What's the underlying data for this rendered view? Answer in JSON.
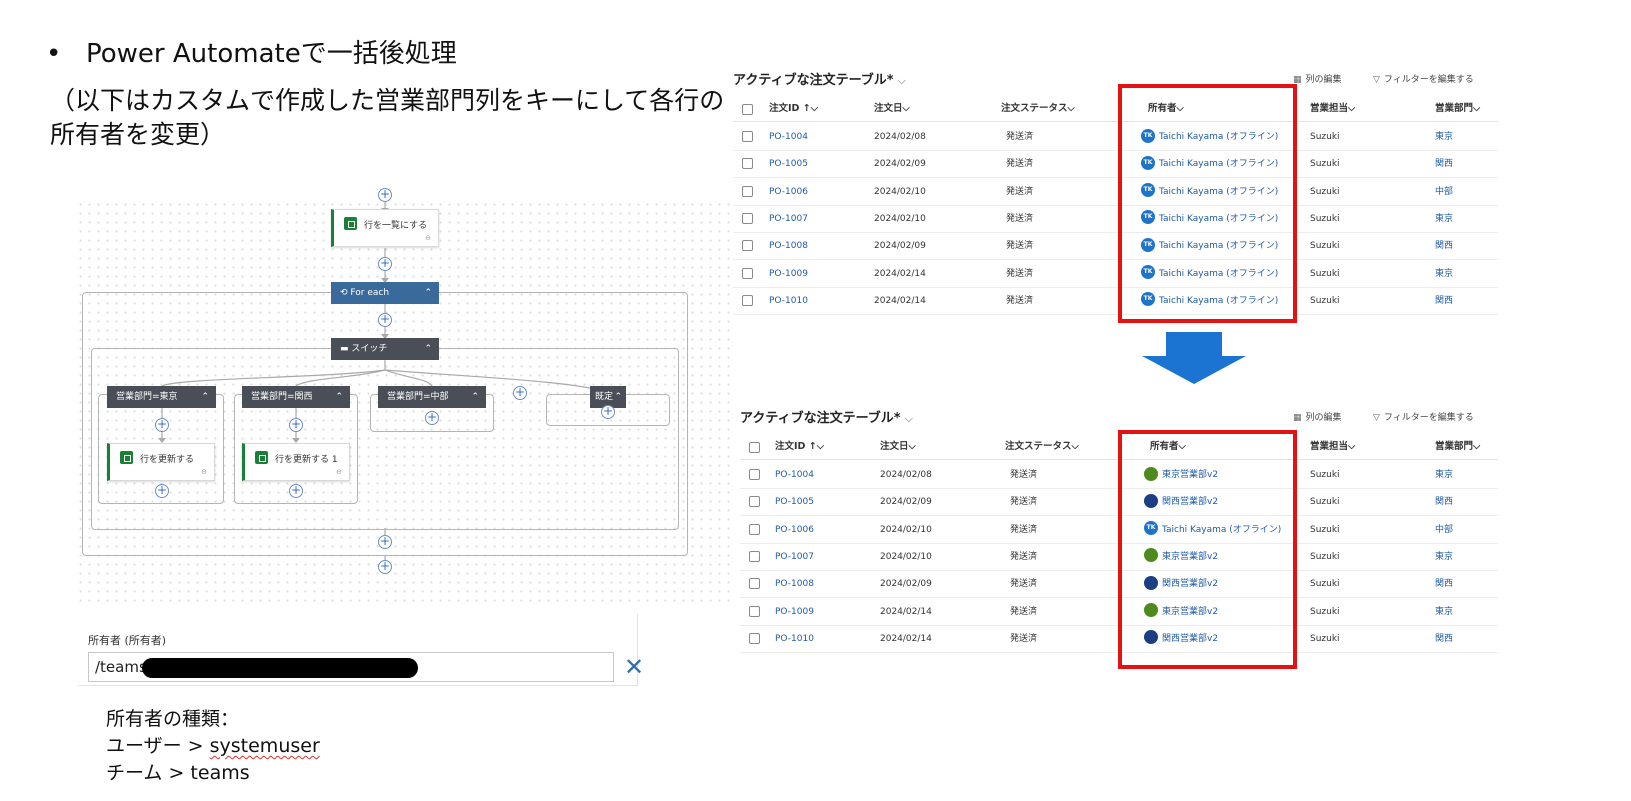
{
  "slide": {
    "bullet": "Power Automateで一括後処理",
    "subtitle": "（以下はカスタムで作成した営業部門列をキーにして各行の所有者を変更）"
  },
  "flow": {
    "list_rows_label": "行を一覧にする",
    "for_each_label": "For each",
    "switch_label": "スイッチ",
    "case_tokyo_label": "営業部門=東京",
    "case_kansai_label": "営業部門=関西",
    "case_chubu_label": "営業部門=中部",
    "default_label": "既定",
    "update_row_label": "行を更新する",
    "update_row_1_label": "行を更新する 1",
    "colors": {
      "action": "#1a7f37",
      "foreach": "#3a6a9c",
      "control": "#4a4f57",
      "plus": "#3a6cc2"
    },
    "icons": [
      "add-step-icon",
      "dataverse-icon",
      "link-icon",
      "loop-icon",
      "switch-icon",
      "chevron-up-icon"
    ]
  },
  "owner_field": {
    "label": "所有者 (所有者)",
    "value": "/teams/",
    "clear_icon": "close-icon"
  },
  "notes": {
    "title": "所有者の種類：",
    "user_line_prefix": "ユーザー > ",
    "user_line_value": "systemuser",
    "team_line": "チーム > teams"
  },
  "table": {
    "title": "アクティブな注文テーブル*",
    "title_chevron": "⌵",
    "edit_columns": "列の編集",
    "edit_filters": "フィルターを編集する",
    "columns": {
      "order_id": "注文ID ↑⌵",
      "order_date": "注文日⌵",
      "status": "注文ステータス⌵",
      "owner": "所有者⌵",
      "sales_rep": "営業担当⌵",
      "department": "営業部門⌵"
    },
    "highlight_color": "#e41212",
    "arrow_color": "#1b74d1"
  },
  "before_rows": [
    {
      "id": "PO-1004",
      "date": "2024/02/08",
      "status": "発送済",
      "owner": "Taichi Kayama (オフライン)",
      "owner_initials": "TK",
      "owner_type": "tk",
      "rep": "Suzuki",
      "dept": "東京"
    },
    {
      "id": "PO-1005",
      "date": "2024/02/09",
      "status": "発送済",
      "owner": "Taichi Kayama (オフライン)",
      "owner_initials": "TK",
      "owner_type": "tk",
      "rep": "Suzuki",
      "dept": "関西"
    },
    {
      "id": "PO-1006",
      "date": "2024/02/10",
      "status": "発送済",
      "owner": "Taichi Kayama (オフライン)",
      "owner_initials": "TK",
      "owner_type": "tk",
      "rep": "Suzuki",
      "dept": "中部"
    },
    {
      "id": "PO-1007",
      "date": "2024/02/10",
      "status": "発送済",
      "owner": "Taichi Kayama (オフライン)",
      "owner_initials": "TK",
      "owner_type": "tk",
      "rep": "Suzuki",
      "dept": "東京"
    },
    {
      "id": "PO-1008",
      "date": "2024/02/09",
      "status": "発送済",
      "owner": "Taichi Kayama (オフライン)",
      "owner_initials": "TK",
      "owner_type": "tk",
      "rep": "Suzuki",
      "dept": "関西"
    },
    {
      "id": "PO-1009",
      "date": "2024/02/14",
      "status": "発送済",
      "owner": "Taichi Kayama (オフライン)",
      "owner_initials": "TK",
      "owner_type": "tk",
      "rep": "Suzuki",
      "dept": "東京"
    },
    {
      "id": "PO-1010",
      "date": "2024/02/14",
      "status": "発送済",
      "owner": "Taichi Kayama (オフライン)",
      "owner_initials": "TK",
      "owner_type": "tk",
      "rep": "Suzuki",
      "dept": "関西"
    }
  ],
  "after_rows": [
    {
      "id": "PO-1004",
      "date": "2024/02/08",
      "status": "発送済",
      "owner": "東京営業部v2",
      "owner_initials": "",
      "owner_type": "green",
      "rep": "Suzuki",
      "dept": "東京"
    },
    {
      "id": "PO-1005",
      "date": "2024/02/09",
      "status": "発送済",
      "owner": "関西営業部v2",
      "owner_initials": "",
      "owner_type": "navy",
      "rep": "Suzuki",
      "dept": "関西"
    },
    {
      "id": "PO-1006",
      "date": "2024/02/10",
      "status": "発送済",
      "owner": "Taichi Kayama (オフライン)",
      "owner_initials": "TK",
      "owner_type": "tk",
      "rep": "Suzuki",
      "dept": "中部"
    },
    {
      "id": "PO-1007",
      "date": "2024/02/10",
      "status": "発送済",
      "owner": "東京営業部v2",
      "owner_initials": "",
      "owner_type": "green",
      "rep": "Suzuki",
      "dept": "東京"
    },
    {
      "id": "PO-1008",
      "date": "2024/02/09",
      "status": "発送済",
      "owner": "関西営業部v2",
      "owner_initials": "",
      "owner_type": "navy",
      "rep": "Suzuki",
      "dept": "関西"
    },
    {
      "id": "PO-1009",
      "date": "2024/02/14",
      "status": "発送済",
      "owner": "東京営業部v2",
      "owner_initials": "",
      "owner_type": "green",
      "rep": "Suzuki",
      "dept": "東京"
    },
    {
      "id": "PO-1010",
      "date": "2024/02/14",
      "status": "発送済",
      "owner": "関西営業部v2",
      "owner_initials": "",
      "owner_type": "navy",
      "rep": "Suzuki",
      "dept": "関西"
    }
  ]
}
